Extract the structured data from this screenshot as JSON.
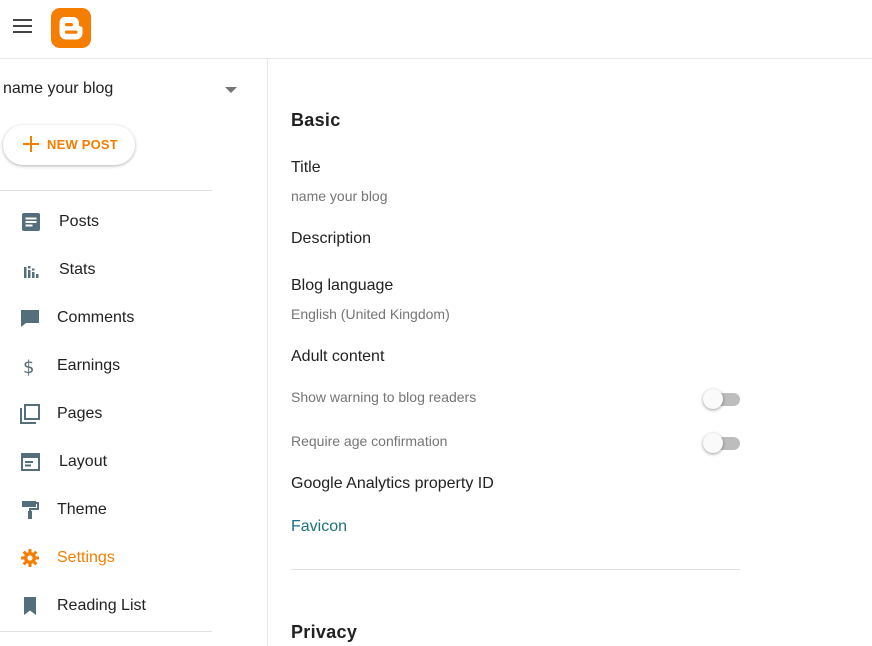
{
  "sidebar": {
    "blog_name": "name your blog",
    "new_post_label": "NEW POST",
    "items": [
      {
        "label": "Posts",
        "icon": "posts-icon"
      },
      {
        "label": "Stats",
        "icon": "stats-icon"
      },
      {
        "label": "Comments",
        "icon": "comments-icon"
      },
      {
        "label": "Earnings",
        "icon": "dollar-icon"
      },
      {
        "label": "Pages",
        "icon": "pages-icon"
      },
      {
        "label": "Layout",
        "icon": "layout-icon"
      },
      {
        "label": "Theme",
        "icon": "paint-roller-icon"
      },
      {
        "label": "Settings",
        "icon": "gear-icon",
        "active": true
      },
      {
        "label": "Reading List",
        "icon": "bookmark-icon"
      }
    ]
  },
  "main": {
    "basic": {
      "heading": "Basic",
      "title_label": "Title",
      "title_value": "name your blog",
      "description_label": "Description",
      "language_label": "Blog language",
      "language_value": "English (United Kingdom)",
      "adult_label": "Adult content",
      "show_warning_label": "Show warning to blog readers",
      "show_warning_on": false,
      "age_confirmation_label": "Require age confirmation",
      "age_confirmation_on": false,
      "analytics_label": "Google Analytics property ID",
      "favicon_label": "Favicon"
    },
    "privacy": {
      "heading": "Privacy"
    }
  },
  "colors": {
    "brand": "#f57d00",
    "link": "#1a737e",
    "icon": "#546e7a"
  }
}
